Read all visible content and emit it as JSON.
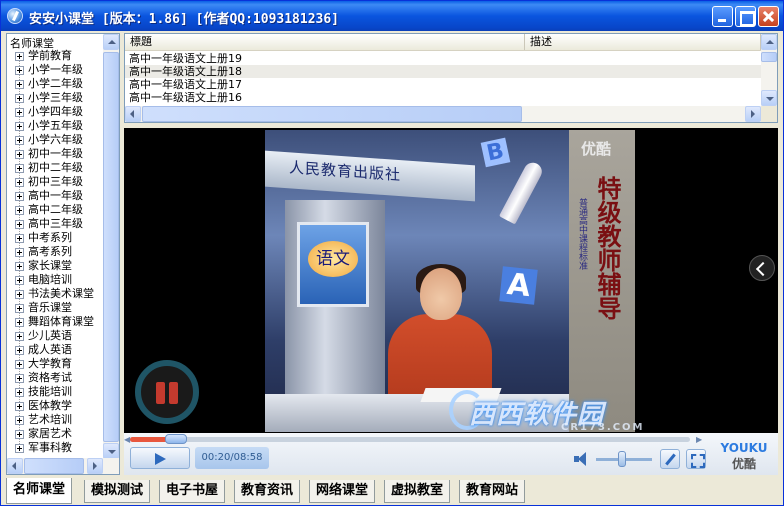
{
  "window": {
    "title": "安安小课堂 [版本：1.86] [作者QQ:1093181236]"
  },
  "tree": {
    "root": "名师课堂",
    "items": [
      "学前教育",
      "小学一年级",
      "小学二年级",
      "小学三年级",
      "小学四年级",
      "小学五年级",
      "小学六年级",
      "初中一年级",
      "初中二年级",
      "初中三年级",
      "高中一年级",
      "高中二年级",
      "高中三年级",
      "中考系列",
      "高考系列",
      "家长课堂",
      "电脑培训",
      "书法美术课堂",
      "音乐课堂",
      "舞蹈体育课堂",
      "少儿英语",
      "成人英语",
      "大学教育",
      "资格考试",
      "技能培训",
      "医体教学",
      "艺术培训",
      "家居艺术",
      "军事科教"
    ]
  },
  "listview": {
    "columns": [
      "標題",
      "描述"
    ],
    "rows": [
      "高中一年级语文上册19",
      "高中一年级语文上册18",
      "高中一年级语文上册17",
      "高中一年级语文上册16"
    ],
    "selected_index": 1
  },
  "player": {
    "time": "00:20/08:58",
    "progress_fraction": 0.037,
    "volume_fraction": 0.5,
    "brand_en": "YOUKU",
    "brand_cn": "优酷",
    "video": {
      "corner_logo": "优酷",
      "side_title": "特级教师辅导",
      "side_subtitle": "普通高中课程标准",
      "banner_text": "人民教育出版社",
      "screen_text": "语文",
      "letter_b": "B",
      "letter_a": "A"
    }
  },
  "watermark": {
    "main": "西西软件园",
    "sub": "CR173.COM"
  },
  "tabs": [
    "名师课堂",
    "模拟测试",
    "电子书屋",
    "教育资讯",
    "网络课堂",
    "虚拟教室",
    "教育网站"
  ],
  "active_tab": 0
}
